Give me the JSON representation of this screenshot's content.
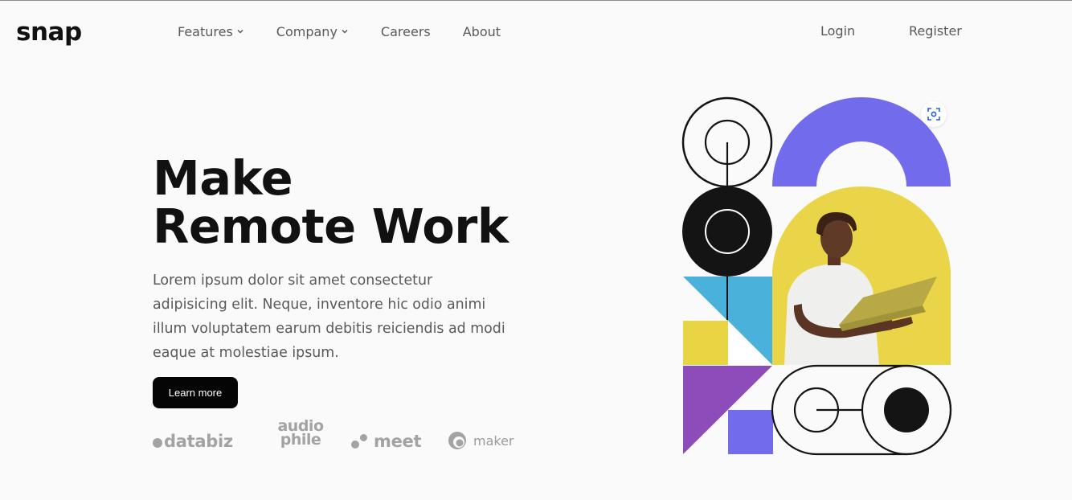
{
  "brand": {
    "logo": "snap"
  },
  "nav": {
    "items": [
      {
        "label": "Features",
        "has_dropdown": true
      },
      {
        "label": "Company",
        "has_dropdown": true
      },
      {
        "label": "Careers",
        "has_dropdown": false
      },
      {
        "label": "About",
        "has_dropdown": false
      }
    ]
  },
  "auth": {
    "login": "Login",
    "register": "Register"
  },
  "hero": {
    "title_line1": "Make",
    "title_line2": "Remote Work",
    "description": "Lorem ipsum dolor sit amet consectetur adipisicing elit. Neque, inventore hic odio animi illum voluptatem earum debitis reiciendis ad modi eaque at molestiae ipsum.",
    "cta_label": "Learn more"
  },
  "clients": {
    "databiz": "databiz",
    "audiophile_top": "audio",
    "audiophile_bottom": "phile",
    "meet": "meet",
    "maker": "maker"
  },
  "colors": {
    "text_dark": "#111111",
    "text_gray": "#595959",
    "logo_gray": "#a3a3a3",
    "purple": "#726ced",
    "yellow": "#e9d544",
    "blue": "#4ab1da",
    "violet": "#8d4cba",
    "black": "#141414",
    "button_bg": "#050505"
  },
  "icons": {
    "chevron": "chevron-down-icon",
    "expand": "focus-expand-icon"
  }
}
